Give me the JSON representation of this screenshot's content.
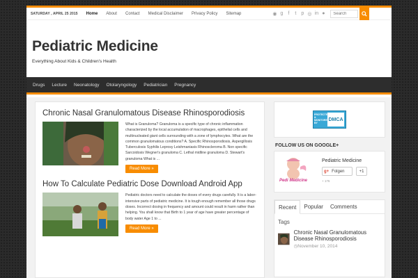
{
  "topbar": {
    "date": "SATURDAY , APRIL 25 2015",
    "nav": [
      "Home",
      "About",
      "Contact",
      "Medical Disclaimer",
      "Privacy Policy",
      "Sitemap"
    ],
    "search_placeholder": "Search"
  },
  "header": {
    "title": "Pediatric Medicine",
    "tagline": "Everything About Kids & Children's Health"
  },
  "mainnav": [
    "Drugs",
    "Lecture",
    "Neonatology",
    "Otolaryngology",
    "Pediatrician",
    "Pregnancy"
  ],
  "posts": [
    {
      "title": "Chronic Nasal Granulomatous Disease Rhinosporodiosis",
      "excerpt": "What is Granuloma? Granuloma is a specific type of chronic inflammation characterized by the local accumulation of macrophages, epithelial cells and multinucleated giant cells surrounding with a zone of lymphocytes. What are the common granulomatous conditions? A. Specific Rhinosporodiosis, Aspergillosis Tuberculosis Syphilis Leprosy Leishmaniasis Rhinoscleroma B. Non specific Sarcoidosis Wegner's granuloma C. Lethal midline granuloma D. Stewart's granuloma What is ...",
      "read_more": "Read More »"
    },
    {
      "title": "How To Calculate Pediatric Dose Download Android App",
      "excerpt": "Pediatric doctors need to calculate the doses of every drugs carefully. It is a labor-intensive parts of pediatric medicine. It is tough enough remember all those drugs doses. Incorrect dosing in frequency and amount could result in harm rather than helping. You shall know that Birth to 1 year of age have greater percentage of body water Age 1 to ...",
      "read_more": "Read More »"
    }
  ],
  "sidebar": {
    "dmca_left": "PROTECTED & MONITORED BY",
    "dmca_right": "DMCA",
    "gplus_title": "FOLLOW US ON GOOGLE+",
    "gplus_name": "Pediatric Medicine",
    "gplus_logo": "Pedi Medicine",
    "follow_label": "Folgen",
    "plus_count": "+1",
    "followers": "+ 176",
    "tabs": [
      "Recent",
      "Popular",
      "Comments"
    ],
    "tags_label": "Tags",
    "recent_title": "Chronic Nasal Granulomatous Disease Rhinosporodiosis",
    "recent_date": "November 10, 2014"
  },
  "colors": {
    "accent": "#f88c00",
    "nav_bg": "#2d2d2d"
  },
  "icons": [
    "rss-icon",
    "google-plus-icon",
    "facebook-icon",
    "twitter-icon",
    "pinterest-icon",
    "dribbble-icon",
    "linkedin-icon",
    "flickr-icon",
    "search-icon"
  ]
}
